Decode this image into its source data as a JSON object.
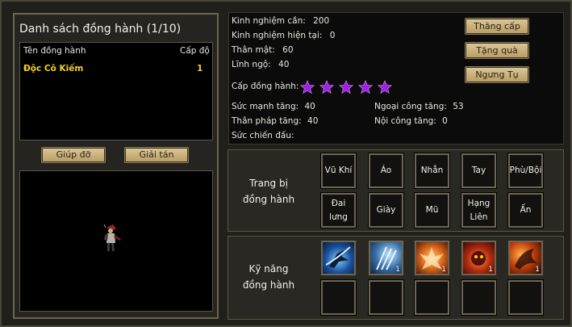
{
  "companion_list": {
    "title": "Danh sách đồng hành (1/10)",
    "col_name": "Tên đồng hành",
    "col_level": "Cấp độ",
    "rows": [
      {
        "name": "Độc Cô Kiếm",
        "level": "1"
      }
    ],
    "help_button": "Giúp đỡ",
    "dismiss_button": "Giải tán"
  },
  "stats": {
    "exp_needed_label": "Kinh nghiệm cần:",
    "exp_needed": "200",
    "exp_current_label": "Kinh nghiệm hiện tại:",
    "exp_current": "0",
    "intimacy_label": "Thân mật:",
    "intimacy": "60",
    "comprehension_label": "Lĩnh ngộ:",
    "comprehension": "40",
    "companion_level_label": "Cấp đồng hành:",
    "stars": 5,
    "strength_label": "Sức mạnh tăng:",
    "strength": "40",
    "agility_label": "Thân pháp tăng:",
    "agility": "40",
    "combat_power_label": "Sức chiến đấu:",
    "outer_attack_label": "Ngoại công tăng:",
    "outer_attack": "53",
    "inner_attack_label": "Nội công tăng:",
    "inner_attack": "0"
  },
  "actions": {
    "level_up": "Thăng cấp",
    "gift": "Tặng quà",
    "condense": "Ngưng Tụ"
  },
  "equipment": {
    "label_line1": "Trang bị",
    "label_line2": "đồng hành",
    "slots_row1": [
      "Vũ Khí",
      "Áo",
      "Nhẫn",
      "Tay",
      "Phù/Bội"
    ],
    "slots_row2_line1": [
      "Đai",
      "Giày",
      "Mũ",
      "Hạng",
      "Ấn"
    ],
    "slots_row2_line2": [
      "lưng",
      "",
      "",
      "Liên",
      ""
    ]
  },
  "skills": {
    "label_line1": "Kỹ năng",
    "label_line2": "đồng hành",
    "counts": [
      "",
      "1",
      "1",
      "1",
      "1"
    ]
  },
  "colors": {
    "star": "#a020e0",
    "name_highlight": "#f0d028"
  }
}
